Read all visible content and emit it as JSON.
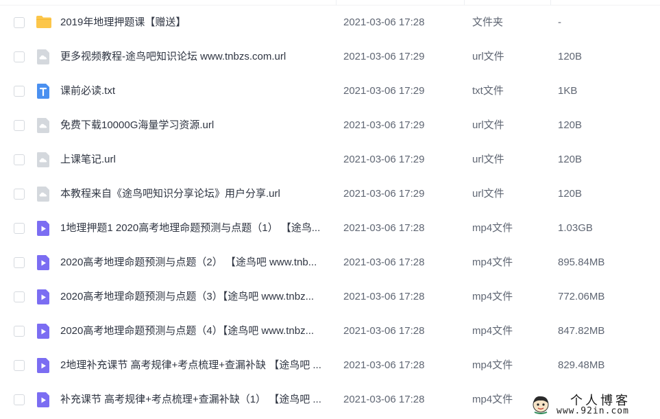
{
  "files": [
    {
      "name": "2019年地理押题课【赠送】",
      "time": "2021-03-06 17:28",
      "type": "文件夹",
      "size": "-",
      "icon": "folder-icon"
    },
    {
      "name": "更多视频教程-途鸟吧知识论坛 www.tnbzs.com.url",
      "time": "2021-03-06 17:29",
      "type": "url文件",
      "size": "120B",
      "icon": "url-file-icon"
    },
    {
      "name": "课前必读.txt",
      "time": "2021-03-06 17:29",
      "type": "txt文件",
      "size": "1KB",
      "icon": "txt-file-icon"
    },
    {
      "name": "免费下载10000G海量学习资源.url",
      "time": "2021-03-06 17:29",
      "type": "url文件",
      "size": "120B",
      "icon": "url-file-icon"
    },
    {
      "name": "上课笔记.url",
      "time": "2021-03-06 17:29",
      "type": "url文件",
      "size": "120B",
      "icon": "url-file-icon"
    },
    {
      "name": "本教程来自《途鸟吧知识分享论坛》用户分享.url",
      "time": "2021-03-06 17:29",
      "type": "url文件",
      "size": "120B",
      "icon": "url-file-icon"
    },
    {
      "name": "1地理押题1 2020高考地理命题预测与点题（1） 【途鸟...",
      "time": "2021-03-06 17:28",
      "type": "mp4文件",
      "size": "1.03GB",
      "icon": "video-file-icon"
    },
    {
      "name": "2020高考地理命题预测与点题（2） 【途鸟吧 www.tnb...",
      "time": "2021-03-06 17:28",
      "type": "mp4文件",
      "size": "895.84MB",
      "icon": "video-file-icon"
    },
    {
      "name": "2020高考地理命题预测与点题（3）【途鸟吧 www.tnbz...",
      "time": "2021-03-06 17:28",
      "type": "mp4文件",
      "size": "772.06MB",
      "icon": "video-file-icon"
    },
    {
      "name": "2020高考地理命题预测与点题（4）【途鸟吧 www.tnbz...",
      "time": "2021-03-06 17:28",
      "type": "mp4文件",
      "size": "847.82MB",
      "icon": "video-file-icon"
    },
    {
      "name": "2地理补充课节 高考规律+考点梳理+查漏补缺 【途鸟吧 ...",
      "time": "2021-03-06 17:28",
      "type": "mp4文件",
      "size": "829.48MB",
      "icon": "video-file-icon"
    },
    {
      "name": "补充课节 高考规律+考点梳理+查漏补缺（1） 【途鸟吧 ...",
      "time": "2021-03-06 17:28",
      "type": "mp4文件",
      "size": "",
      "icon": "video-file-icon"
    }
  ],
  "watermark": {
    "title": "个人博客",
    "url": "www.92in.com"
  },
  "colors": {
    "folder": "#fcc64a",
    "url_file": "#d4d8dd",
    "txt_file": "#4a90f0",
    "video_file": "#7b6df2",
    "checkbox_border": "#d5d9de"
  }
}
